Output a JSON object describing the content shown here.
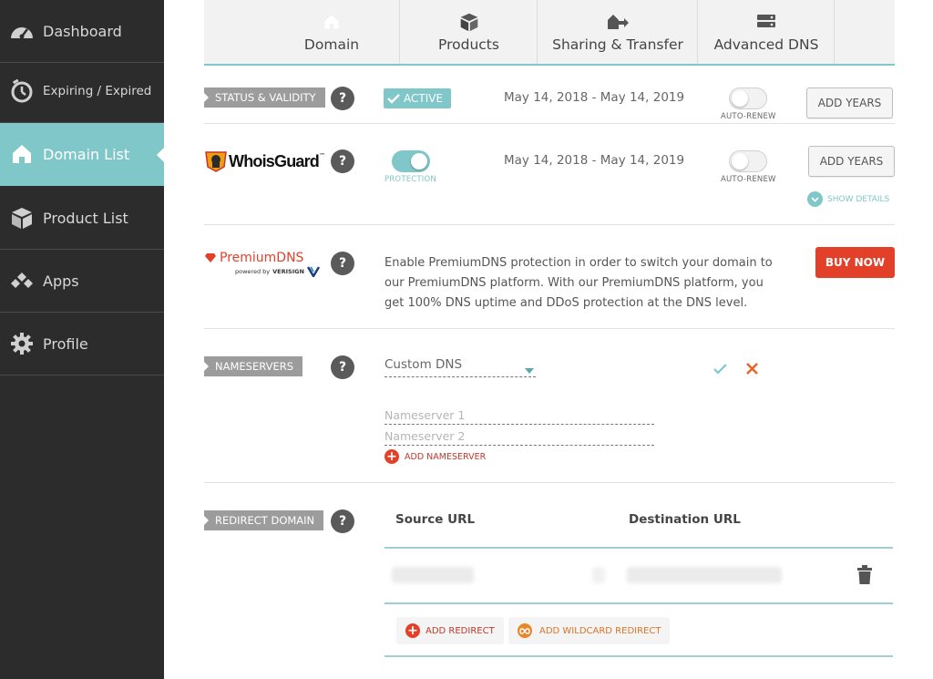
{
  "sidebar": {
    "items": [
      {
        "label": "Dashboard",
        "icon": "dashboard-icon"
      },
      {
        "label": "Expiring / Expired",
        "icon": "timer-icon"
      },
      {
        "label": "Domain List",
        "icon": "home-icon",
        "active": true
      },
      {
        "label": "Product List",
        "icon": "box-icon"
      },
      {
        "label": "Apps",
        "icon": "apps-icon"
      },
      {
        "label": "Profile",
        "icon": "gear-icon"
      }
    ]
  },
  "tabs": [
    {
      "label": "Domain",
      "icon": "home-icon",
      "active": true
    },
    {
      "label": "Products",
      "icon": "box-icon"
    },
    {
      "label": "Sharing & Transfer",
      "icon": "transfer-icon"
    },
    {
      "label": "Advanced DNS",
      "icon": "server-icon"
    }
  ],
  "status": {
    "label": "STATUS & VALIDITY",
    "badge": "ACTIVE",
    "dates": "May 14, 2018  -  May 14, 2019",
    "toggle_label": "AUTO-RENEW",
    "button": "ADD YEARS"
  },
  "whoisguard": {
    "logo_text": "WhoisGuard",
    "logo_tm": "™",
    "protection_label": "PROTECTION",
    "dates": "May 14, 2018  -  May 14, 2019",
    "toggle_label": "AUTO-RENEW",
    "button": "ADD YEARS",
    "show_details": "SHOW DETAILS"
  },
  "premiumdns": {
    "logo_text": "PremiumDNS",
    "powered_by": "powered by",
    "brand": "VERISIGN",
    "description": "Enable PremiumDNS protection in order to switch your domain to our PremiumDNS platform. With our PremiumDNS platform, you get 100% DNS uptime and DDoS protection at the DNS level.",
    "button": "BUY NOW"
  },
  "nameservers": {
    "label": "NAMESERVERS",
    "selected": "Custom DNS",
    "ns1_placeholder": "Nameserver 1",
    "ns2_placeholder": "Nameserver 2",
    "add_label": "ADD NAMESERVER"
  },
  "redirect": {
    "label": "REDIRECT DOMAIN",
    "col_source": "Source URL",
    "col_dest": "Destination URL",
    "add_redirect": "ADD REDIRECT",
    "add_wildcard": "ADD WILDCARD REDIRECT"
  },
  "colors": {
    "teal": "#80c7c9",
    "sidebar_bg": "#2c2c2c",
    "red": "#e3402a",
    "orange": "#e8862a",
    "label_gray": "#9c9c9c"
  }
}
